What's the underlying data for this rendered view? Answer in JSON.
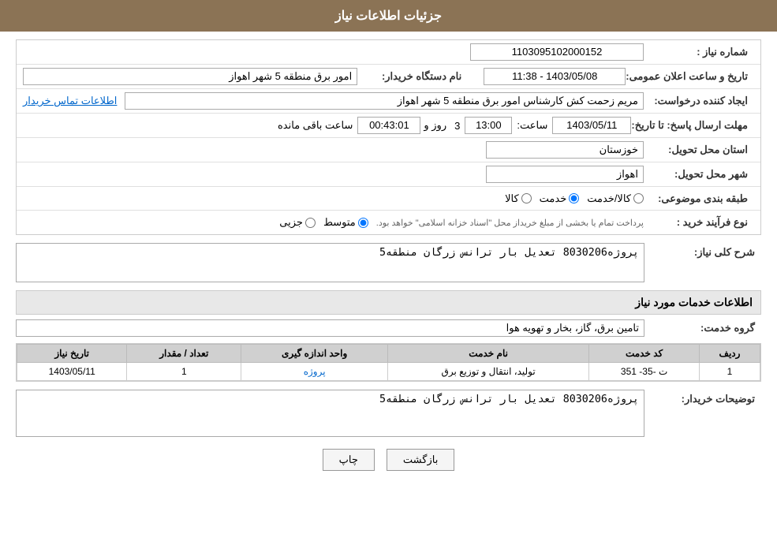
{
  "header": {
    "title": "جزئیات اطلاعات نیاز"
  },
  "form": {
    "need_number_label": "شماره نیاز :",
    "need_number_value": "1103095102000152",
    "buyer_org_label": "نام دستگاه خریدار:",
    "buyer_org_value": "امور برق منطقه 5 شهر اهواز",
    "announce_date_label": "تاریخ و ساعت اعلان عمومی:",
    "announce_date_value": "1403/05/08 - 11:38",
    "creator_label": "ایجاد کننده درخواست:",
    "creator_value": "مریم زحمت کش کارشناس امور برق منطقه 5 شهر اهواز",
    "contact_info_link": "اطلاعات تماس خریدار",
    "response_deadline_label": "مهلت ارسال پاسخ: تا تاریخ:",
    "response_date_value": "1403/05/11",
    "response_time_label": "ساعت:",
    "response_time_value": "13:00",
    "remaining_days_value": "3",
    "remaining_time_value": "00:43:01",
    "days_label": "روز و",
    "hours_label": "ساعت باقی مانده",
    "province_label": "استان محل تحویل:",
    "province_value": "خوزستان",
    "city_label": "شهر محل تحویل:",
    "city_value": "اهواز",
    "category_label": "طبقه بندی موضوعی:",
    "category_options": [
      {
        "label": "کالا",
        "value": "kala"
      },
      {
        "label": "خدمت",
        "value": "khedmat"
      },
      {
        "label": "کالا/خدمت",
        "value": "kala_khedmat"
      }
    ],
    "category_selected": "khedmat",
    "purchase_type_label": "نوع فرآیند خرید :",
    "purchase_options": [
      {
        "label": "جزیی",
        "value": "jozi"
      },
      {
        "label": "متوسط",
        "value": "motevaset"
      }
    ],
    "purchase_selected": "motevaset",
    "purchase_note": "پرداخت تمام یا بخشی از مبلغ خریداز محل \"اسناد خزانه اسلامی\" خواهد بود.",
    "need_description_label": "شرح کلی نیاز:",
    "need_description_value": "پروژه8030206 تعدیل بار ترانس زرگان منطقه5",
    "services_title": "اطلاعات خدمات مورد نیاز",
    "service_group_label": "گروه خدمت:",
    "service_group_value": "تامین برق، گاز، بخار و تهویه هوا",
    "table": {
      "headers": [
        "ردیف",
        "کد خدمت",
        "نام خدمت",
        "واحد اندازه گیری",
        "تعداد / مقدار",
        "تاریخ نیاز"
      ],
      "rows": [
        {
          "row_num": "1",
          "service_code": "ت -35- 351",
          "service_name": "تولید، انتقال و توزیع برق",
          "unit": "پروژه",
          "quantity": "1",
          "date": "1403/05/11"
        }
      ]
    },
    "buyer_notes_label": "توضیحات خریدار:",
    "buyer_notes_value": "پروژه8030206 تعدیل بار ترانس زرگان منطقه5"
  },
  "buttons": {
    "print_label": "چاپ",
    "back_label": "بازگشت"
  }
}
